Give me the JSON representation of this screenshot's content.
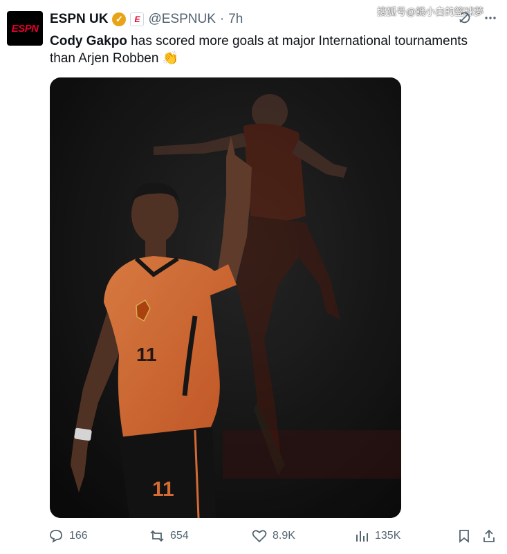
{
  "account": {
    "avatar_text": "ESPN",
    "name": "ESPN UK",
    "affiliate_badge": "E",
    "handle": "@ESPNUK",
    "separator": "·",
    "time": "7h"
  },
  "watermark": "搜狐号@饑小白的籃球夢",
  "tweet": {
    "bold_name": "Cody Gakpo",
    "text": " has scored more goals at major International tournaments than Arjen Robben ",
    "emoji": "👏"
  },
  "media": {
    "jersey_number_front": "11",
    "shorts_number": "11"
  },
  "actions": {
    "replies": "166",
    "reposts": "654",
    "likes": "8.9K",
    "views": "135K"
  },
  "colors": {
    "espn_red": "#e4002b",
    "jersey_orange": "#f07a3c",
    "verified_gold": "#e8a317",
    "text_secondary": "#536471"
  }
}
